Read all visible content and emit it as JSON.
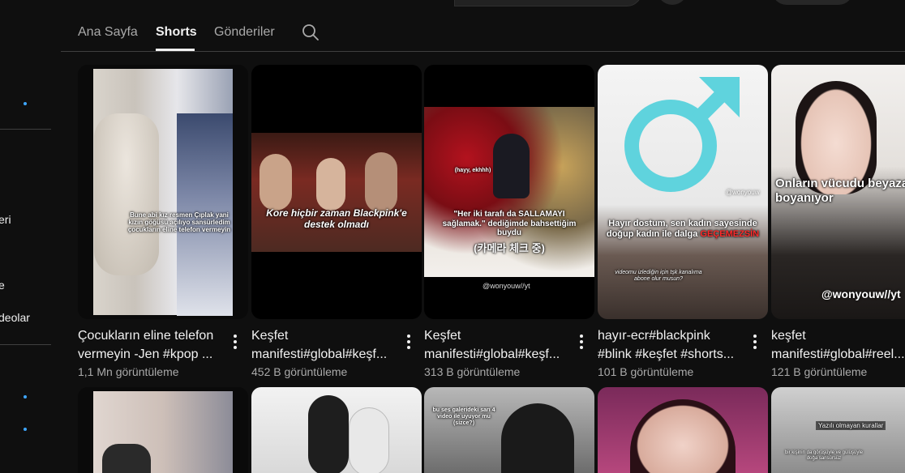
{
  "sidebar": {
    "partial_items": [
      {
        "text": "eri"
      },
      {
        "text": "e"
      },
      {
        "text": "deolar"
      }
    ]
  },
  "tabs": [
    {
      "label": "Ana Sayfa",
      "active": false
    },
    {
      "label": "Shorts",
      "active": true
    },
    {
      "label": "Gönderiler",
      "active": false
    }
  ],
  "icons": {
    "tab_search": "search-icon",
    "card_menu": "more-vert-icon"
  },
  "colors": {
    "background": "#0f0f0f",
    "text_primary": "#f1f1f1",
    "text_secondary": "#aaaaaa",
    "divider": "#3f3f3f",
    "accent_dot": "#3ea6ff"
  },
  "shorts": [
    {
      "title": "Çocukların eline telefon vermeyin -Jen #kpop ...",
      "views": "1,1 Mn görüntüleme",
      "caption": "Bune abi kız resmen Çıplak yani kızın göğüsü açılıyo sansürledim çocukların eline telefon vermeyin"
    },
    {
      "title": "Keşfet manifesti#global#keşf...",
      "views": "452 B görüntüleme",
      "caption": "Kore hiçbir zaman Blackpink'e destek olmadı"
    },
    {
      "title": "Keşfet manifesti#global#keşf...",
      "views": "313 B görüntüleme",
      "caption": "\"Her iki tarafı da SALLAMAYI sağlamak.\" dediğimde bahsettiğim buydu",
      "caption_korean": "(카메라 체크 중)",
      "small_caption": "(hayy, ekhhh)",
      "handle": "@wonyouw//yt"
    },
    {
      "title": "hayır-ecr#blackpink #blink #keşfet #shorts...",
      "views": "101 B görüntüleme",
      "caption": "Hayır dostum, sen kadın sayesinde doğup kadın ile dalga",
      "caption_highlight": "GEÇEMEZSİN",
      "small_caption": "videomu izlediğin için tşk kanalıma abone olur musun?",
      "handle": "@wonyouw"
    },
    {
      "title": "keşfet manifesti#global#reel...",
      "views": "121 B görüntüleme",
      "caption": "Onların vücudu beyaza boyanıyor",
      "handle": "@wonyouw//yt"
    }
  ],
  "shorts_row2": [
    {
      "caption": ""
    },
    {
      "caption": ""
    },
    {
      "caption": "bu ses galerideki sarı 4 video ile uyuyor mu (sizce?)"
    },
    {
      "caption": ""
    },
    {
      "caption": "Yazılı olmayan kurallar",
      "small_caption": "bir kişinin da görüşüyle ve gülüşüyle doğa sansürsüz"
    }
  ]
}
